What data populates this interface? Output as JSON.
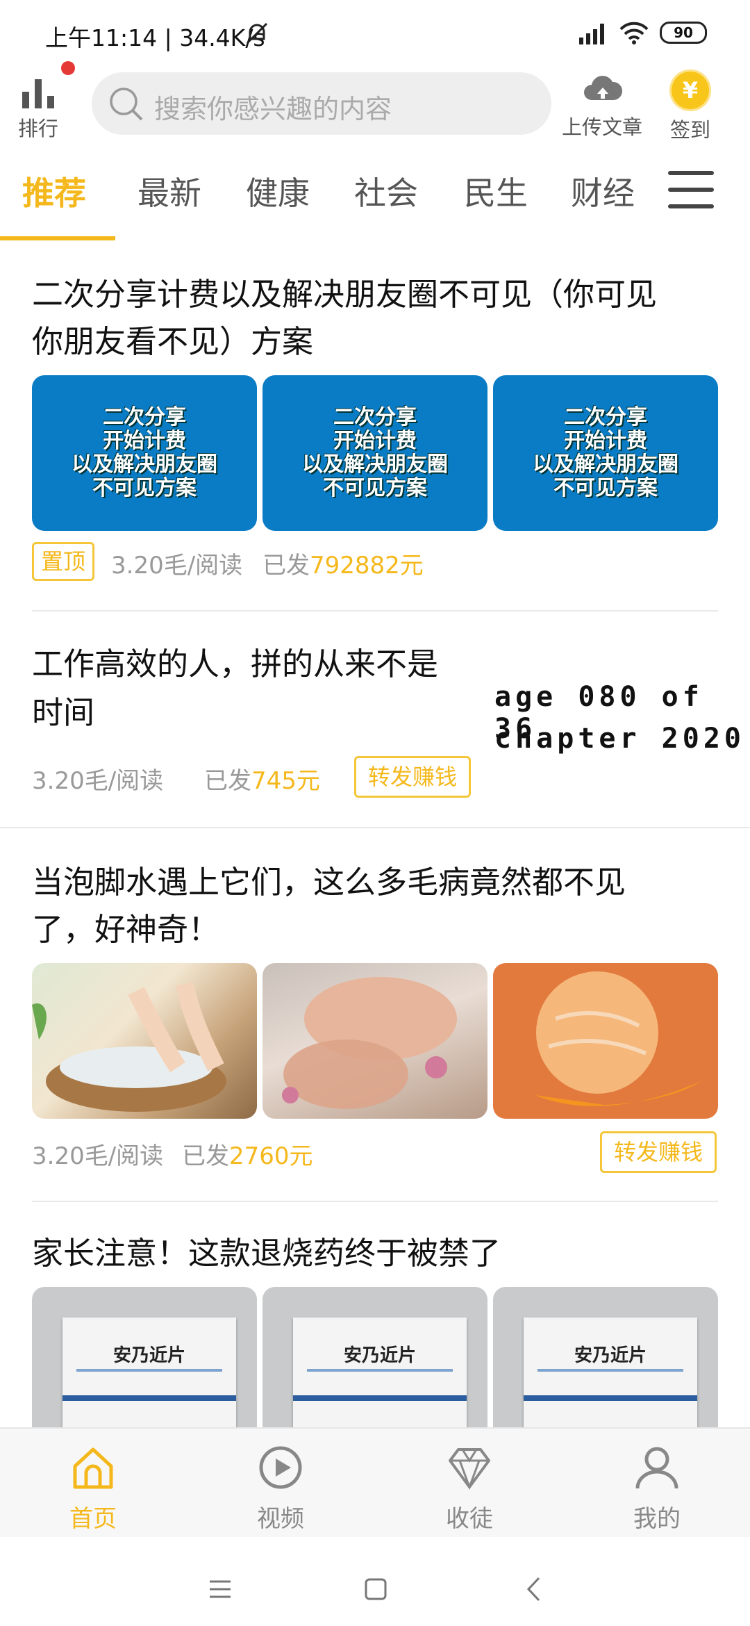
{
  "status_bar": {
    "time": "上午11:14 | 34.4K/s",
    "battery": "90"
  },
  "header": {
    "rank_label": "排行",
    "search_placeholder": "搜索你感兴趣的内容",
    "upload_label": "上传文章",
    "signin_label": "签到",
    "signin_coin": "¥"
  },
  "tabs": [
    "推荐",
    "最新",
    "健康",
    "社会",
    "民生",
    "财经"
  ],
  "articles": [
    {
      "title_line1": "二次分享计费以及解决朋友圈不可见（你可见",
      "title_line2": "你朋友看不见）方案",
      "image_text": [
        "二次分享",
        "开始计费",
        "以及解决朋友圈",
        "不可见方案"
      ],
      "badge": "置顶",
      "price": "3.20毛/阅读",
      "paid_prefix": "已发",
      "paid_amount": "792882元"
    },
    {
      "title_line1": "工作高效的人，拼的从来不是",
      "title_line2": "时间",
      "side_text_line1": "age 080 of 36",
      "side_text_line2": "chapter 2020",
      "price": "3.20毛/阅读",
      "paid_prefix": "已发",
      "paid_amount": "745元",
      "badge": "转发赚钱"
    },
    {
      "title_line1": "当泡脚水遇上它们，这么多毛病竟然都不见",
      "title_line2": "了，好神奇！",
      "price": "3.20毛/阅读",
      "paid_prefix": "已发",
      "paid_amount": "2760元",
      "badge": "转发赚钱"
    },
    {
      "title_line1": "家长注意！这款退烧药终于被禁了",
      "image_text": "安乃近片"
    }
  ],
  "bottom_nav": [
    "首页",
    "视频",
    "收徒",
    "我的"
  ],
  "colors": {
    "accent": "#f5b81c",
    "badge_border": "#f5c63a",
    "tile_blue": "#0a7cc5"
  }
}
